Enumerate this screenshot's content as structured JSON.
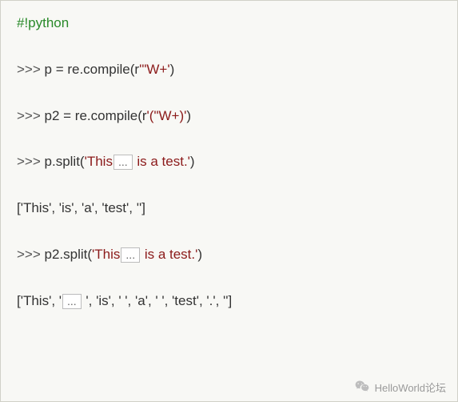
{
  "lines": {
    "shebang": "#!python",
    "l1_prompt": ">>> ",
    "l1_rest_a": "p = re.compile(r",
    "l1_str": "'\"W+'",
    "l1_rest_b": ")",
    "l2_prompt": ">>> ",
    "l2_rest_a": "p2 = re.compile(r",
    "l2_str": "'(\"W+)'",
    "l2_rest_b": ")",
    "l3_prompt": ">>> ",
    "l3_rest_a": "p.split(",
    "l3_str_a": "'This",
    "l3_ellipsis": "...",
    "l3_str_b": " is a test.'",
    "l3_rest_b": ")",
    "l4_result": "['This', 'is', 'a', 'test', '']",
    "l5_prompt": ">>> ",
    "l5_rest_a": "p2.split(",
    "l5_str_a": "'This",
    "l5_ellipsis": "...",
    "l5_str_b": " is a test.'",
    "l5_rest_b": ")",
    "l6_a": "['This', '",
    "l6_ellipsis": "...",
    "l6_b": " ', 'is', ' ', 'a', ' ', 'test', '.', '']"
  },
  "footer": {
    "text": "HelloWorld论坛"
  }
}
